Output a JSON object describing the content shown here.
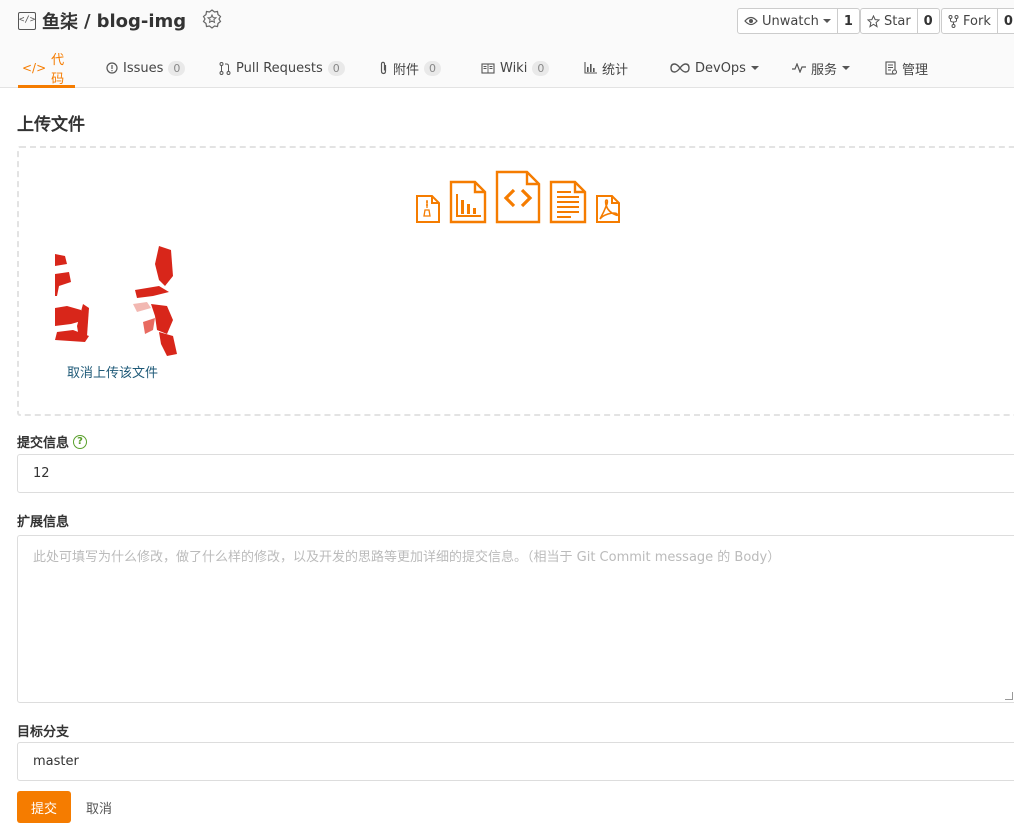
{
  "repo": {
    "owner": "鱼柒",
    "separator": "/",
    "name": "blog-img"
  },
  "actions": {
    "unwatch_label": "Unwatch",
    "unwatch_count": "1",
    "star_label": "Star",
    "star_count": "0",
    "fork_label": "Fork",
    "fork_count": "0"
  },
  "tabs": [
    {
      "label": "代码",
      "icon": "code-icon",
      "count": null,
      "active": true
    },
    {
      "label": "Issues",
      "icon": "issue-icon",
      "count": "0"
    },
    {
      "label": "Pull Requests",
      "icon": "pull-request-icon",
      "count": "0"
    },
    {
      "label": "附件",
      "icon": "paperclip-icon",
      "count": "0"
    },
    {
      "label": "Wiki",
      "icon": "book-icon",
      "count": "0"
    },
    {
      "label": "统计",
      "icon": "bar-chart-icon",
      "count": null
    },
    {
      "label": "DevOps",
      "icon": "infinity-icon",
      "count": null
    },
    {
      "label": "服务",
      "icon": "pulse-icon",
      "count": null
    },
    {
      "label": "管理",
      "icon": "settings-doc-icon",
      "count": null
    }
  ],
  "page": {
    "title": "上传文件",
    "cancel_upload": "取消上传该文件"
  },
  "form": {
    "commit_label": "提交信息",
    "commit_value": "12",
    "ext_label": "扩展信息",
    "ext_placeholder": "此处可填写为什么修改，做了什么样的修改，以及开发的思路等更加详细的提交信息。（相当于 Git Commit message 的 Body）",
    "branch_label": "目标分支",
    "branch_value": "master",
    "submit": "提交",
    "cancel": "取消"
  },
  "colors": {
    "accent": "#f57c00",
    "link": "#1f5a78",
    "help": "#5aa02c"
  }
}
